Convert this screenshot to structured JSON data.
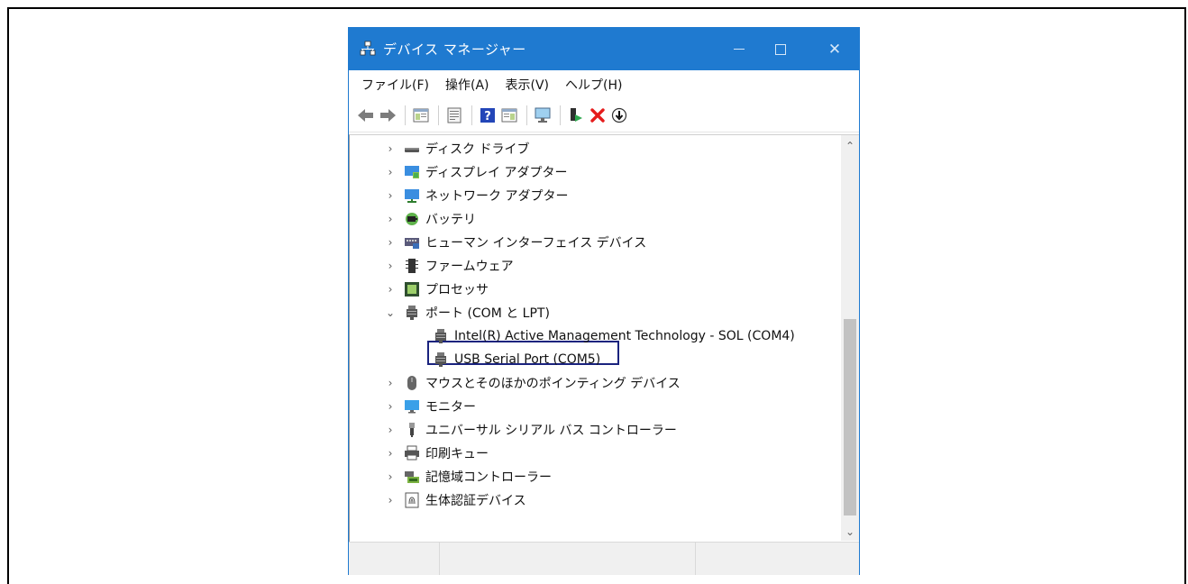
{
  "window": {
    "title": "デバイス マネージャー",
    "accent_color": "#1f7ad0",
    "controls": {
      "close": "✕"
    }
  },
  "menu": [
    "ファイル(F)",
    "操作(A)",
    "表示(V)",
    "ヘルプ(H)"
  ],
  "toolbar": {
    "buttons": [
      "back-icon",
      "forward-icon",
      "properties-icon",
      "details-icon",
      "help-icon",
      "view-icon",
      "monitor-icon",
      "update-driver-icon",
      "uninstall-icon",
      "download-icon"
    ],
    "help_label": "?"
  },
  "tree": {
    "items": [
      {
        "label": "ディスク ドライブ",
        "icon": "disk-drive-icon",
        "expanded": false
      },
      {
        "label": "ディスプレイ アダプター",
        "icon": "display-adapter-icon",
        "expanded": false
      },
      {
        "label": "ネットワーク アダプター",
        "icon": "network-adapter-icon",
        "expanded": false
      },
      {
        "label": "バッテリ",
        "icon": "battery-icon",
        "expanded": false
      },
      {
        "label": "ヒューマン インターフェイス デバイス",
        "icon": "hid-icon",
        "expanded": false
      },
      {
        "label": "ファームウェア",
        "icon": "firmware-icon",
        "expanded": false
      },
      {
        "label": "プロセッサ",
        "icon": "processor-icon",
        "expanded": false
      },
      {
        "label": "ポート (COM と LPT)",
        "icon": "port-icon",
        "expanded": true
      },
      {
        "label": "Intel(R) Active Management Technology - SOL (COM4)",
        "icon": "port-icon",
        "child": true
      },
      {
        "label": "USB Serial Port (COM5)",
        "icon": "port-icon",
        "child": true,
        "highlighted": true
      },
      {
        "label": "マウスとそのほかのポインティング デバイス",
        "icon": "mouse-icon",
        "expanded": false
      },
      {
        "label": "モニター",
        "icon": "monitor-icon",
        "expanded": false
      },
      {
        "label": "ユニバーサル シリアル バス コントローラー",
        "icon": "usb-icon",
        "expanded": false
      },
      {
        "label": "印刷キュー",
        "icon": "printer-icon",
        "expanded": false
      },
      {
        "label": "記憶域コントローラー",
        "icon": "storage-controller-icon",
        "expanded": false
      },
      {
        "label": "生体認証デバイス",
        "icon": "biometric-icon",
        "expanded": false
      }
    ],
    "expander_collapsed": "›",
    "expander_expanded": "⌄"
  },
  "scrollbar": {
    "up": "⌃",
    "down": "⌄"
  }
}
